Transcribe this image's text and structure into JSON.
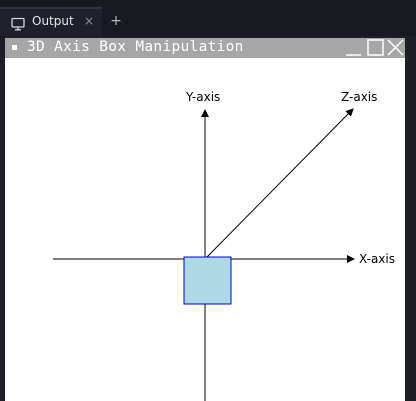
{
  "tab": {
    "label": "Output",
    "close_glyph": "×",
    "add_glyph": "+",
    "icon": "monitor-icon"
  },
  "window": {
    "title": "3D Axis Box Manipulation",
    "controls": [
      "minimize-icon",
      "maximize-icon",
      "close-icon"
    ]
  },
  "scene": {
    "x_axis_label": "X-axis",
    "y_axis_label": "Y-axis",
    "z_axis_label": "Z-axis",
    "box_fill": "#add8e6",
    "box_stroke": "#0000cc"
  },
  "colors": {
    "tabbar_bg": "#181921",
    "titlebar_bg": "#a6a6a6",
    "canvas_bg": "#ffffff"
  }
}
